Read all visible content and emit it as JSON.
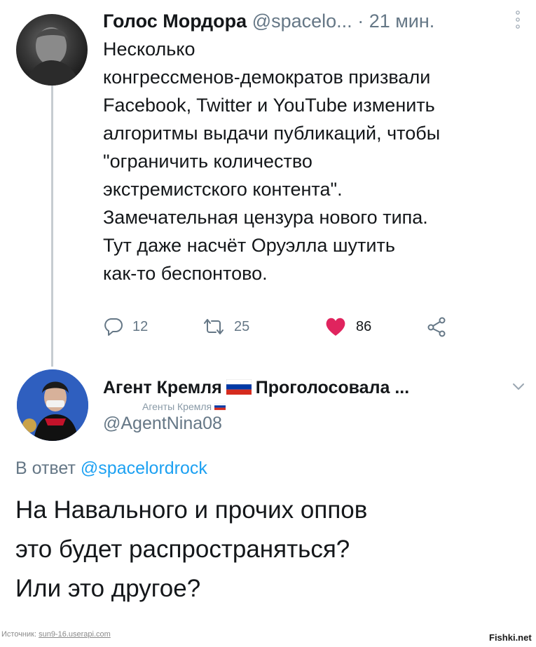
{
  "tweet1": {
    "author_name": "Голос Мордора",
    "author_handle": "@spacelo...",
    "time": "· 21 мин.",
    "body_lines": [
      "Несколько",
      "конгрессменов-демократов призвали",
      "Facebook, Twitter и YouTube изменить",
      "алгоритмы выдачи публикаций, чтобы",
      "\"ограничить количество",
      "экстремистского контента\".",
      "Замечательная цензура нового типа.",
      "Тут даже насчёт Оруэлла шутить",
      "как-то беспонтово."
    ],
    "actions": {
      "reply_count": "12",
      "retweet_count": "25",
      "like_count": "86"
    },
    "icons": [
      "reply-icon",
      "retweet-icon",
      "heart-icon",
      "share-icon",
      "more-dots-icon"
    ],
    "colors": {
      "like": "#e0245e",
      "muted": "#657786"
    }
  },
  "tweet2": {
    "author_name_part1": "Агент Кремля",
    "author_name_part2": "Проголосовала ...",
    "author_subname": "Агенты Кремля",
    "author_handle": "@AgentNina08",
    "reply_prefix": "В ответ",
    "reply_mention": "@spacelordrock",
    "body_lines": [
      "На Навального и прочих оппов",
      "это будет распространяться?",
      "Или это другое?"
    ],
    "icons": [
      "russia-flag-icon",
      "chevron-down-icon"
    ],
    "colors": {
      "mention": "#1da1f2"
    }
  },
  "footer": {
    "source_label": "Источник:",
    "source_link": "sun9-16.userapi.com",
    "watermark": "Fishki.net"
  }
}
